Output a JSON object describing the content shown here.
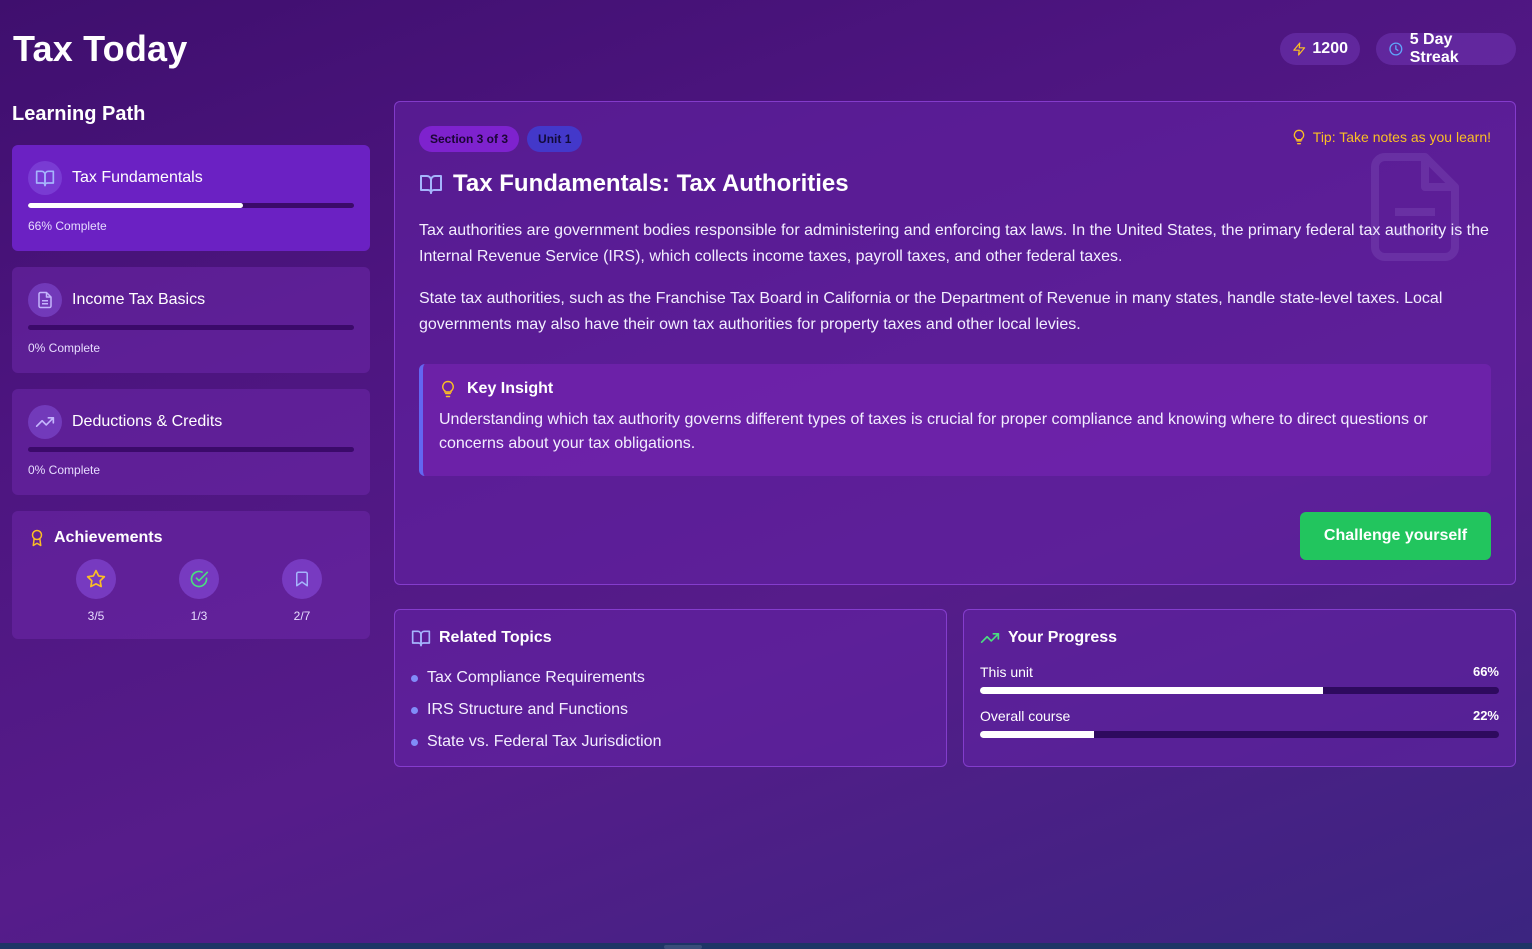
{
  "app": {
    "title": "Tax Today"
  },
  "stats": {
    "points": "1200",
    "streak": "5 Day Streak"
  },
  "sidebar": {
    "heading": "Learning Path",
    "items": [
      {
        "label": "Tax Fundamentals",
        "progress_text": "66% Complete",
        "progress": 0.66,
        "icon": "book-icon",
        "active": true
      },
      {
        "label": "Income Tax Basics",
        "progress_text": "0% Complete",
        "progress": 0,
        "icon": "document-icon",
        "active": false
      },
      {
        "label": "Deductions & Credits",
        "progress_text": "0% Complete",
        "progress": 0,
        "icon": "trend-up-icon",
        "active": false
      }
    ]
  },
  "achievements": {
    "title": "Achievements",
    "items": [
      {
        "icon": "star-icon",
        "count": "3/5"
      },
      {
        "icon": "check-circle-icon",
        "count": "1/3"
      },
      {
        "icon": "bookmark-icon",
        "count": "2/7"
      }
    ]
  },
  "lesson": {
    "section_badge": "Section 3 of 3",
    "unit_badge": "Unit 1",
    "tip": "Tip: Take notes as you learn!",
    "title": "Tax Fundamentals: Tax Authorities",
    "paragraphs": [
      "Tax authorities are government bodies responsible for administering and enforcing tax laws. In the United States, the primary federal tax authority is the Internal Revenue Service (IRS), which collects income taxes, payroll taxes, and other federal taxes.",
      "State tax authorities, such as the Franchise Tax Board in California or the Department of Revenue in many states, handle state-level taxes. Local governments may also have their own tax authorities for property taxes and other local levies."
    ],
    "insight_title": "Key Insight",
    "insight_text": "Understanding which tax authority governs different types of taxes is crucial for proper compliance and knowing where to direct questions or concerns about your tax obligations.",
    "cta": "Challenge yourself"
  },
  "related": {
    "title": "Related Topics",
    "topics": [
      "Tax Compliance Requirements",
      "IRS Structure and Functions",
      "State vs. Federal Tax Jurisdiction"
    ]
  },
  "progress": {
    "title": "Your Progress",
    "rows": [
      {
        "label": "This unit",
        "value_text": "66%",
        "value": 0.66
      },
      {
        "label": "Overall course",
        "value_text": "22%",
        "value": 0.22
      }
    ]
  },
  "colors": {
    "accent_green": "#22c55e",
    "accent_yellow": "#fbbf24",
    "accent_indigo": "#6366f1"
  }
}
